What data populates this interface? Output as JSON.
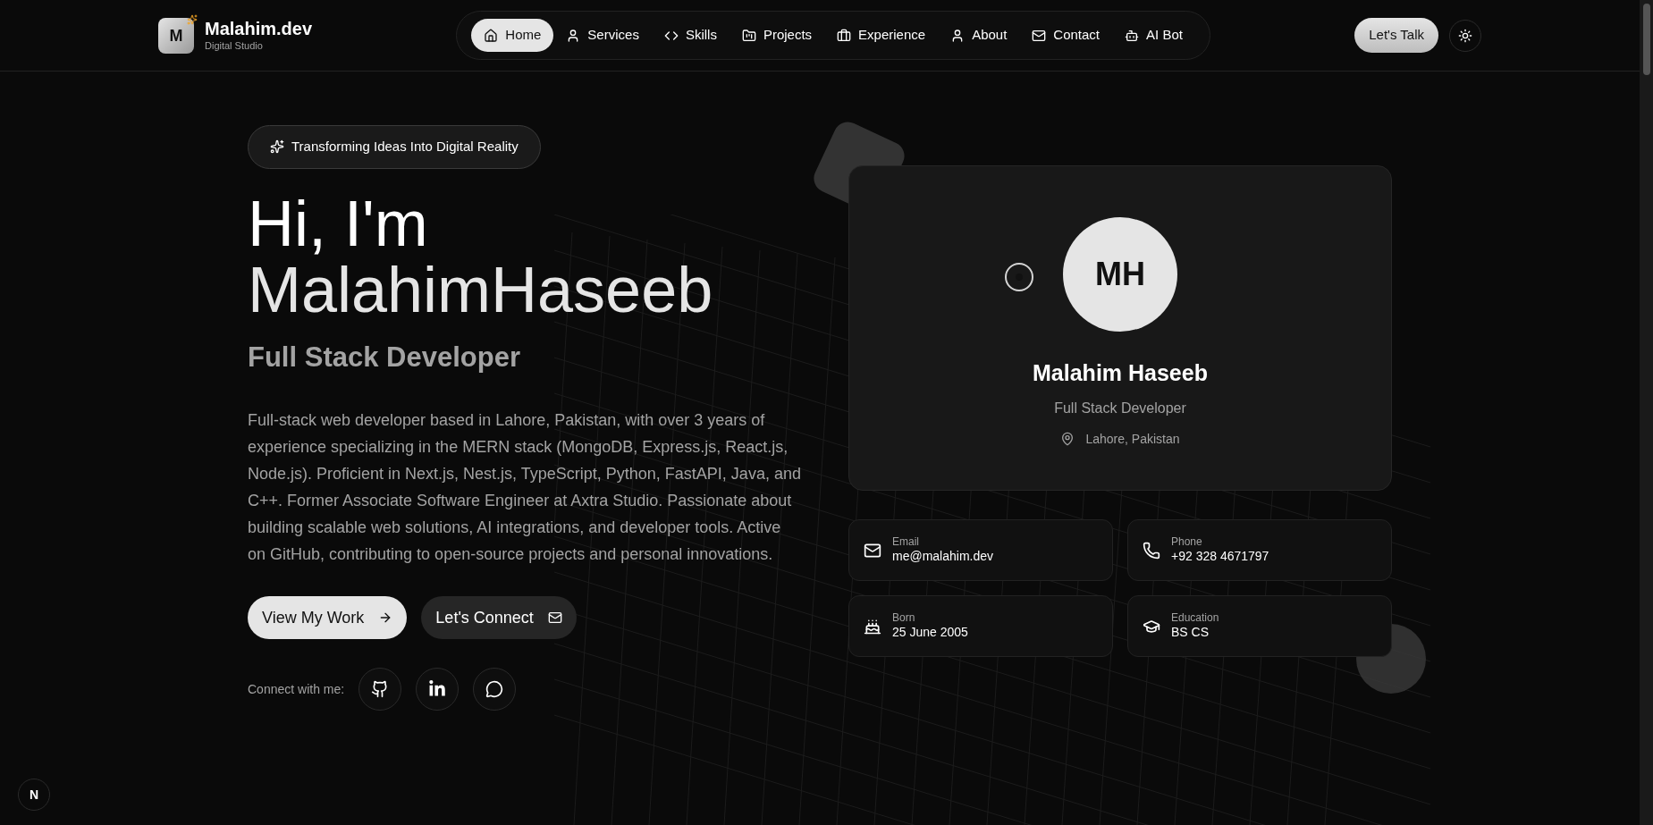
{
  "brand": {
    "logo_letter": "M",
    "name": "Malahim.dev",
    "tagline": "Digital Studio"
  },
  "nav": [
    {
      "label": "Home",
      "kind": "home",
      "selected": true
    },
    {
      "label": "Services",
      "kind": "user",
      "selected": false
    },
    {
      "label": "Skills",
      "kind": "code",
      "selected": false
    },
    {
      "label": "Projects",
      "kind": "folder",
      "selected": false
    },
    {
      "label": "Experience",
      "kind": "briefcase",
      "selected": false
    },
    {
      "label": "About",
      "kind": "user",
      "selected": false
    },
    {
      "label": "Contact",
      "kind": "mail",
      "selected": false
    },
    {
      "label": "AI Bot",
      "kind": "bot",
      "selected": false
    }
  ],
  "cta": "Let's Talk",
  "hero": {
    "badge": "Transforming Ideas Into Digital Reality",
    "greeting": "Hi, I'm",
    "name": "MalahimHaseeb",
    "role": "Full Stack Developer",
    "bio": "Full-stack web developer based in Lahore, Pakistan, with over 3 years of experience specializing in the MERN stack (MongoDB, Express.js, React.js, Node.js). Proficient in Next.js, Nest.js, TypeScript, Python, FastAPI, Java, and C++. Former Associate Software Engineer at Axtra Studio. Passionate about building scalable web solutions, AI integrations, and developer tools. Active on GitHub, contributing to open-source projects and personal innovations.",
    "buttons": [
      {
        "label": "View My Work",
        "kind": "primary"
      },
      {
        "label": "Let's Connect",
        "kind": "secondary"
      }
    ],
    "social_label": "Connect with me:",
    "socials": [
      {
        "kind": "github"
      },
      {
        "kind": "linkedin"
      },
      {
        "kind": "chat"
      }
    ]
  },
  "profile": {
    "initials": "MH",
    "name": "Malahim Haseeb",
    "role": "Full Stack Developer",
    "location": "Lahore, Pakistan"
  },
  "info": [
    {
      "kind": "email",
      "label": "Email",
      "value": "me@malahim.dev"
    },
    {
      "kind": "phone",
      "label": "Phone",
      "value": "+92 328 4671797"
    },
    {
      "kind": "born",
      "label": "Born",
      "value": "25 June 2005"
    },
    {
      "kind": "education",
      "label": "Education",
      "value": "BS CS"
    }
  ],
  "dev_badge": "N"
}
